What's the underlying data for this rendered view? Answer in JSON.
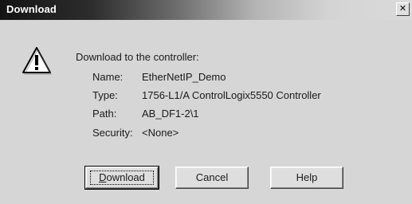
{
  "window": {
    "title": "Download",
    "close_glyph": "✕"
  },
  "icons": {
    "warning": "warning-icon",
    "close": "close-icon"
  },
  "content": {
    "heading": "Download to the controller:",
    "fields": [
      {
        "label": "Name:",
        "value": "EtherNetIP_Demo"
      },
      {
        "label": "Type:",
        "value": "1756-L1/A ControlLogix5550 Controller"
      },
      {
        "label": "Path:",
        "value": "AB_DF1-2\\1"
      },
      {
        "label": "Security:",
        "value": "<None>"
      }
    ]
  },
  "buttons": {
    "download": {
      "mnemonic": "D",
      "rest": "ownload"
    },
    "cancel": "Cancel",
    "help": "Help"
  }
}
